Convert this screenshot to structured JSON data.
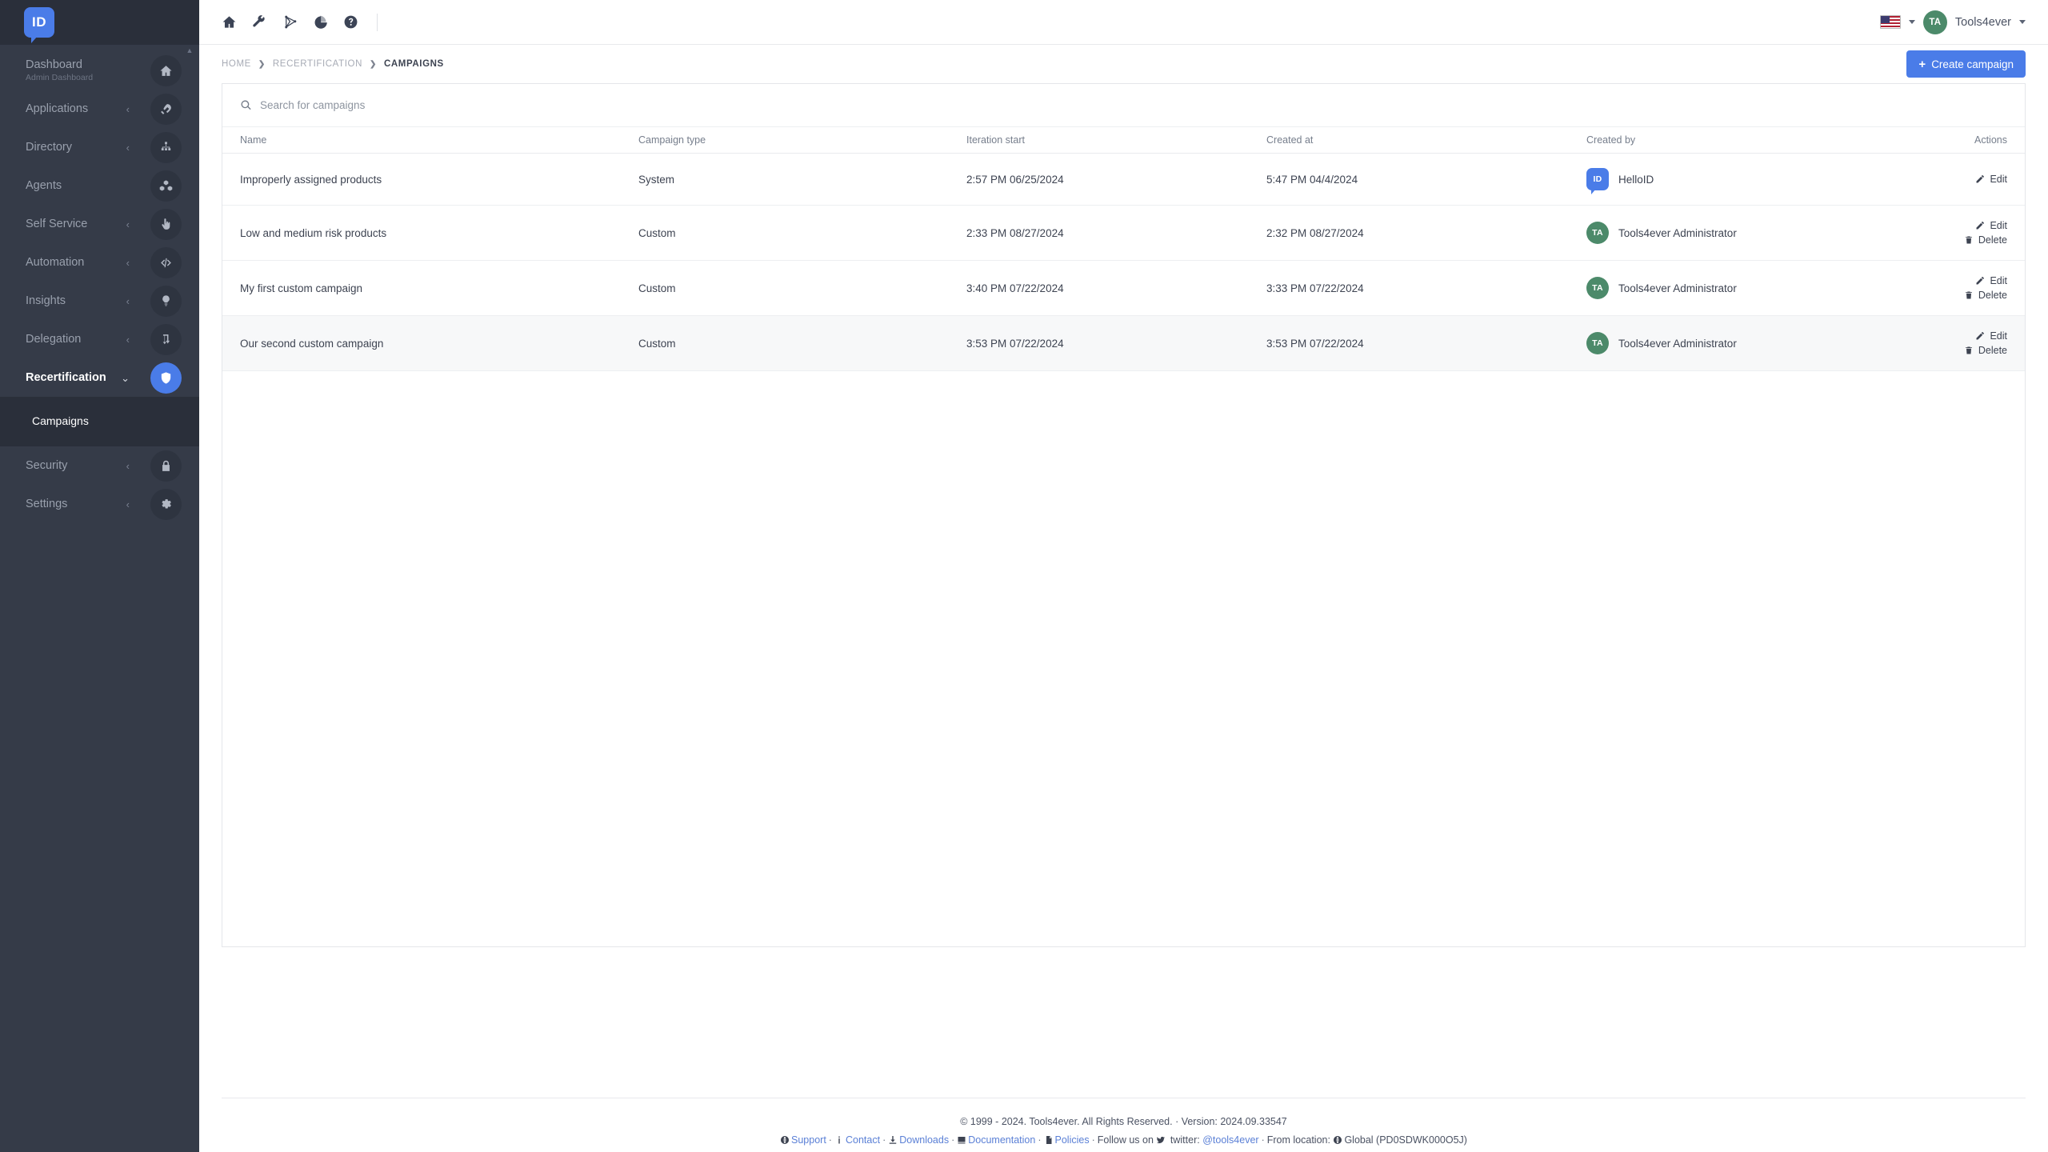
{
  "brand": {
    "logo_text": "ID",
    "accent": "#4a7ce8",
    "sidebar_bg": "#353b48"
  },
  "topbar": {
    "icons": [
      "home-icon",
      "wrench-icon",
      "share-nodes-icon",
      "pie-chart-icon",
      "help-circle-icon"
    ],
    "language_flag": "us-flag-icon",
    "user": {
      "initials": "TA",
      "name": "Tools4ever"
    }
  },
  "breadcrumb": {
    "items": [
      "HOME",
      "RECERTIFICATION",
      "CAMPAIGNS"
    ],
    "separator": "❯"
  },
  "page": {
    "create_button": "Create campaign",
    "create_button_plus": "+"
  },
  "sidebar": {
    "items": [
      {
        "label": "Dashboard",
        "sub": "Admin Dashboard",
        "icon": "home-icon",
        "caret": "",
        "active": false
      },
      {
        "label": "Applications",
        "sub": "",
        "icon": "rocket-icon",
        "caret": "‹",
        "active": false
      },
      {
        "label": "Directory",
        "sub": "",
        "icon": "sitemap-icon",
        "caret": "‹",
        "active": false
      },
      {
        "label": "Agents",
        "sub": "",
        "icon": "cubes-icon",
        "caret": "",
        "active": false
      },
      {
        "label": "Self Service",
        "sub": "",
        "icon": "hand-pointer-icon",
        "caret": "‹",
        "active": false
      },
      {
        "label": "Automation",
        "sub": "",
        "icon": "code-icon",
        "caret": "‹",
        "active": false
      },
      {
        "label": "Insights",
        "sub": "",
        "icon": "lightbulb-icon",
        "caret": "‹",
        "active": false
      },
      {
        "label": "Delegation",
        "sub": "",
        "icon": "arrow-turn-icon",
        "caret": "‹",
        "active": false
      },
      {
        "label": "Recertification",
        "sub": "",
        "icon": "shield-icon",
        "caret": "⌄",
        "active": true
      },
      {
        "label": "Security",
        "sub": "",
        "icon": "lock-icon",
        "caret": "‹",
        "active": false
      },
      {
        "label": "Settings",
        "sub": "",
        "icon": "gear-icon",
        "caret": "‹",
        "active": false
      }
    ],
    "subnav": {
      "parent": "Recertification",
      "items": [
        "Campaigns"
      ]
    }
  },
  "search": {
    "placeholder": "Search for campaigns",
    "value": "",
    "icon": "search-icon"
  },
  "table": {
    "headers": [
      "Name",
      "Campaign type",
      "Iteration start",
      "Created at",
      "Created by",
      "Actions"
    ],
    "rows": [
      {
        "name": "Improperly assigned products",
        "type": "System",
        "iteration_start": "2:57 PM 06/25/2024",
        "created_at": "5:47 PM 04/4/2024",
        "created_by": {
          "initials": "ID",
          "name": "HelloID",
          "avatar_style": "blue"
        },
        "actions": [
          "Edit"
        ],
        "alt": false
      },
      {
        "name": "Low and medium risk products",
        "type": "Custom",
        "iteration_start": "2:33 PM 08/27/2024",
        "created_at": "2:32 PM 08/27/2024",
        "created_by": {
          "initials": "TA",
          "name": "Tools4ever Administrator",
          "avatar_style": "green"
        },
        "actions": [
          "Edit",
          "Delete"
        ],
        "alt": false
      },
      {
        "name": "My first custom campaign",
        "type": "Custom",
        "iteration_start": "3:40 PM 07/22/2024",
        "created_at": "3:33 PM 07/22/2024",
        "created_by": {
          "initials": "TA",
          "name": "Tools4ever Administrator",
          "avatar_style": "green"
        },
        "actions": [
          "Edit",
          "Delete"
        ],
        "alt": false
      },
      {
        "name": "Our second custom campaign",
        "type": "Custom",
        "iteration_start": "3:53 PM 07/22/2024",
        "created_at": "3:53 PM 07/22/2024",
        "created_by": {
          "initials": "TA",
          "name": "Tools4ever Administrator",
          "avatar_style": "green"
        },
        "actions": [
          "Edit",
          "Delete"
        ],
        "alt": true
      }
    ]
  },
  "footer": {
    "line1": "© 1999 - 2024. Tools4ever. All Rights Reserved. · Version: 2024.09.33547",
    "links": [
      {
        "label": "Support",
        "icon": "globe-icon"
      },
      {
        "label": "Contact",
        "icon": "info-icon"
      },
      {
        "label": "Downloads",
        "icon": "download-icon"
      },
      {
        "label": "Documentation",
        "icon": "book-icon"
      },
      {
        "label": "Policies",
        "icon": "file-icon"
      }
    ],
    "follow_text": "Follow us on",
    "twitter_label": "twitter:",
    "twitter_handle": "@tools4ever",
    "location_prefix": "From location:",
    "location": "Global (PD0SDWK000O5J)"
  }
}
